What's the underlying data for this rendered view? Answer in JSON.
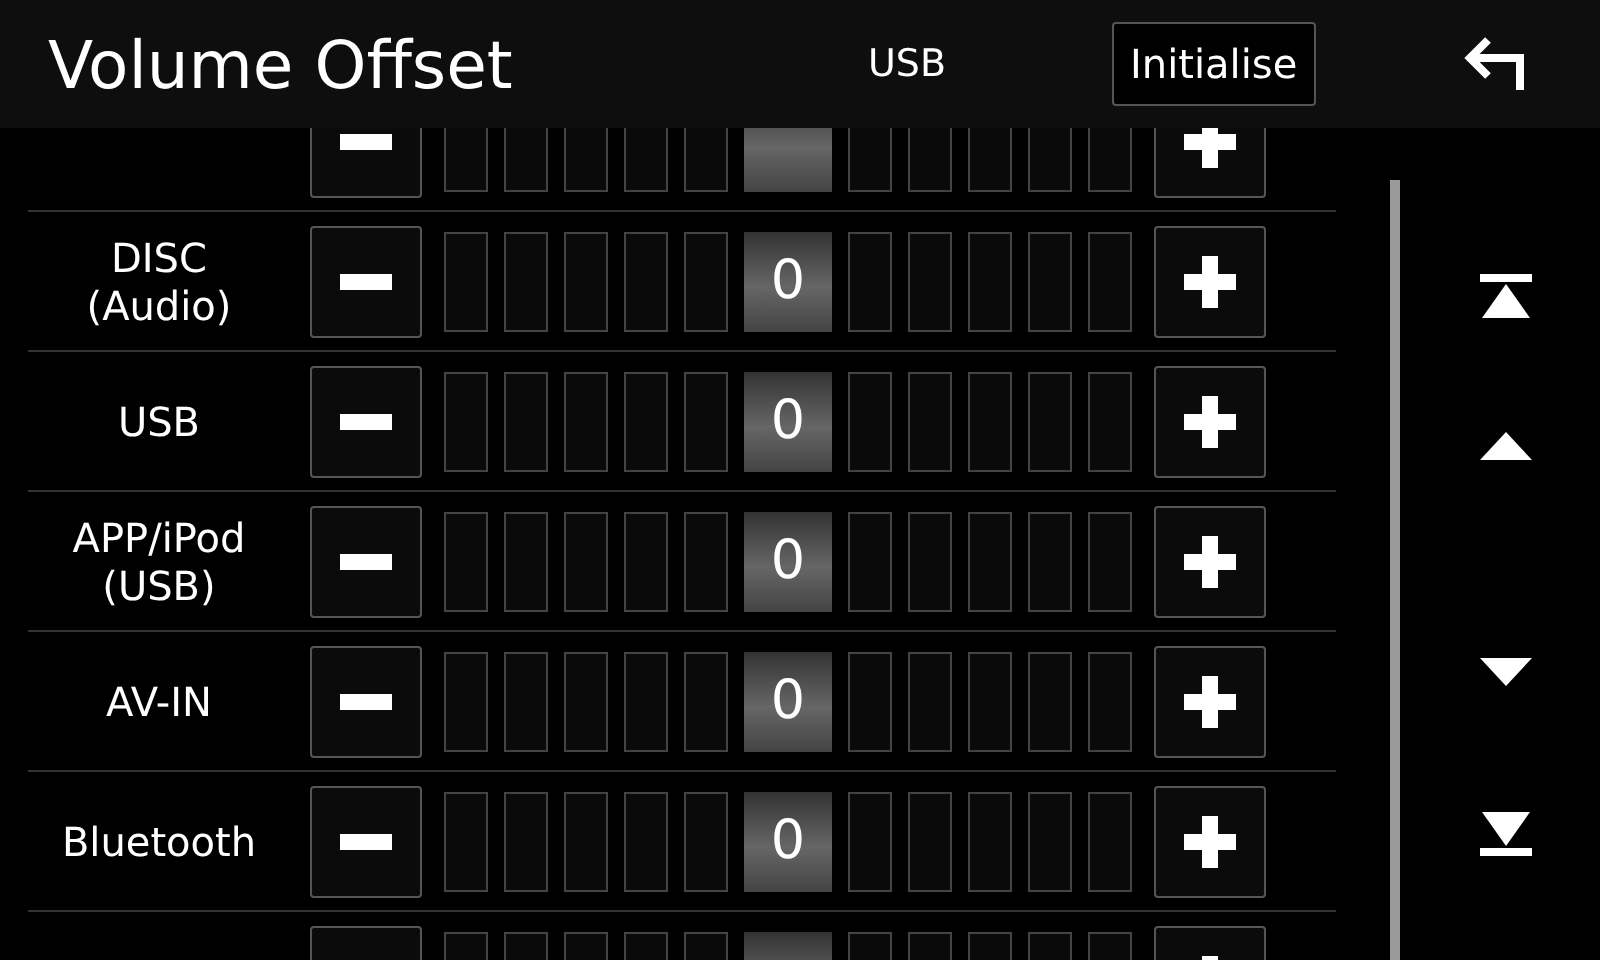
{
  "header": {
    "title": "Volume Offset",
    "source": "USB",
    "initialise_button": "Initialise"
  },
  "rows": [
    {},
    {
      "label": "DISC\n(Audio)",
      "value": "0"
    },
    {
      "label": "USB",
      "value": "0"
    },
    {
      "label": "APP/iPod\n(USB)",
      "value": "0"
    },
    {
      "label": "AV-IN",
      "value": "0"
    },
    {
      "label": "Bluetooth",
      "value": "0"
    },
    {}
  ]
}
